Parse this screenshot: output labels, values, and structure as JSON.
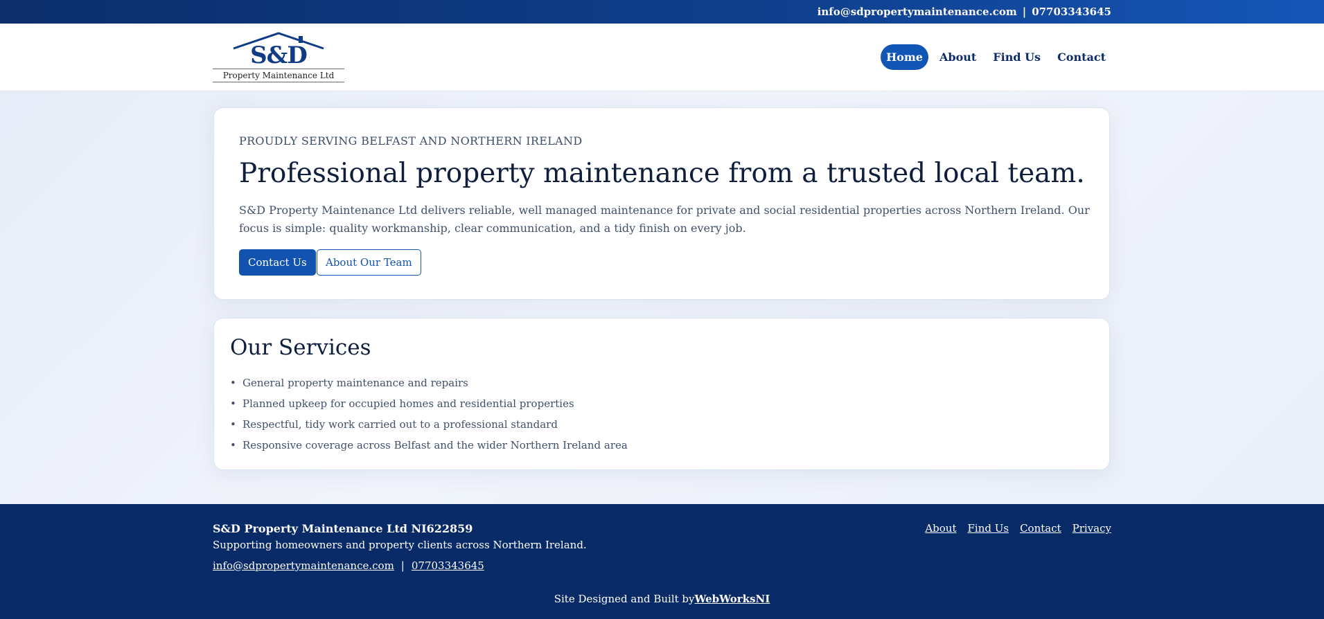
{
  "topbar": {
    "email": "info@sdpropertymaintenance.com",
    "separator": "|",
    "phone": "07703343645"
  },
  "logo": {
    "mark": "S&D",
    "tagline": "Property Maintenance Ltd"
  },
  "nav": {
    "items": [
      {
        "label": "Home",
        "active": true
      },
      {
        "label": "About",
        "active": false
      },
      {
        "label": "Find Us",
        "active": false
      },
      {
        "label": "Contact",
        "active": false
      }
    ]
  },
  "hero": {
    "eyebrow": "PROUDLY SERVING BELFAST AND NORTHERN IRELAND",
    "title": "Professional property maintenance from a trusted local team.",
    "body": "S&D Property Maintenance Ltd delivers reliable, well managed maintenance for private and social residential properties across Northern Ireland. Our focus is simple: quality workmanship, clear communication, and a tidy finish on every job.",
    "primary_button": "Contact Us",
    "secondary_button": "About Our Team"
  },
  "services": {
    "title": "Our Services",
    "items": [
      "General property maintenance and repairs",
      "Planned upkeep for occupied homes and residential properties",
      "Respectful, tidy work carried out to a professional standard",
      "Responsive coverage across Belfast and the wider Northern Ireland area"
    ]
  },
  "footer": {
    "company": "S&D Property Maintenance Ltd NI622859",
    "tagline": "Supporting homeowners and property clients across Northern Ireland.",
    "email": "info@sdpropertymaintenance.com",
    "separator": "|",
    "phone": "07703343645",
    "links": [
      "About",
      "Find Us",
      "Contact",
      "Privacy"
    ],
    "credit_prefix": "Site Designed and Built by",
    "credit_link": "WebWorksNI"
  },
  "colors": {
    "primary": "#1253b0",
    "navy": "#082b68",
    "heading": "#0f1e3d"
  }
}
